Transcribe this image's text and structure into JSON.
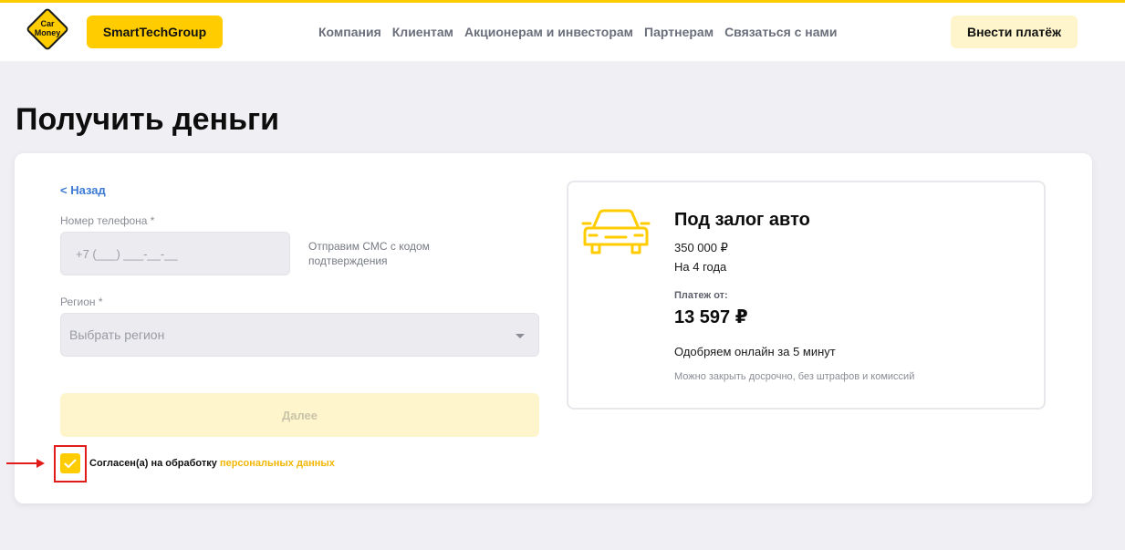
{
  "header": {
    "logo_text_line1": "Car",
    "logo_text_line2": "Money",
    "brand_badge": "SmartTechGroup",
    "nav": [
      "Компания",
      "Клиентам",
      "Акционерам и инвесторам",
      "Партнерам",
      "Связаться с нами"
    ],
    "pay_button": "Внести платёж"
  },
  "page": {
    "title": "Получить деньги"
  },
  "form": {
    "back_label": "< Назад",
    "phone_label": "Номер телефона *",
    "phone_placeholder": "+7  (___) ___-__-__",
    "sms_note": "Отправим СМС с кодом подтверждения",
    "region_label": "Регион *",
    "region_placeholder": "Выбрать регион",
    "next_button": "Далее",
    "consent_text": "Согласен(а) на обработку ",
    "consent_link": "персональных данных",
    "consent_checked": true
  },
  "offer": {
    "icon": "car-icon",
    "title": "Под залог авто",
    "amount": "350 000 ₽",
    "term": "На 4 года",
    "payment_label": "Платеж от:",
    "payment_value": "13 597 ₽",
    "approval": "Одобряем онлайн за 5 минут",
    "early_repay": "Можно закрыть досрочно, без штрафов и комиссий"
  },
  "colors": {
    "accent": "#ffcc00",
    "link": "#3d7bd6",
    "highlight": "#e21b1b"
  }
}
